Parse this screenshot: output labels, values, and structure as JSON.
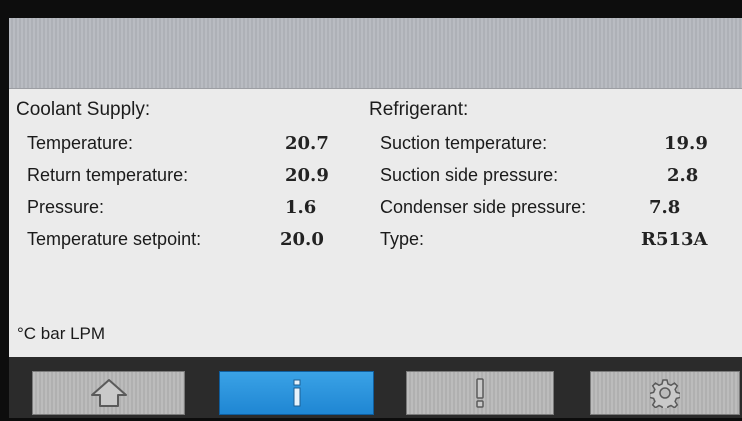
{
  "left": {
    "title": "Coolant Supply:",
    "rows": [
      {
        "label": "Temperature:",
        "value": "20.7"
      },
      {
        "label": "Return temperature:",
        "value": "20.9"
      },
      {
        "label": "Pressure:",
        "value": "1.6"
      },
      {
        "label": "Temperature setpoint:",
        "value": "20.0"
      }
    ],
    "units": "°C  bar  LPM"
  },
  "right": {
    "title": "Refrigerant:",
    "rows": [
      {
        "label": "Suction temperature:",
        "value": "19.9"
      },
      {
        "label": "Suction side pressure:",
        "value": "2.8"
      },
      {
        "label": "Condenser side pressure:",
        "value": "7.8"
      },
      {
        "label": "Type:",
        "value": "R513A"
      }
    ]
  },
  "nav": [
    {
      "icon": "home-icon",
      "active": false
    },
    {
      "icon": "info-icon",
      "active": true
    },
    {
      "icon": "alarm-icon",
      "active": false
    },
    {
      "icon": "gear-icon",
      "active": false
    }
  ],
  "colors": {
    "active_button": "#1f86d3",
    "background": "#ebebeb",
    "navbar": "#2b2b2b"
  }
}
